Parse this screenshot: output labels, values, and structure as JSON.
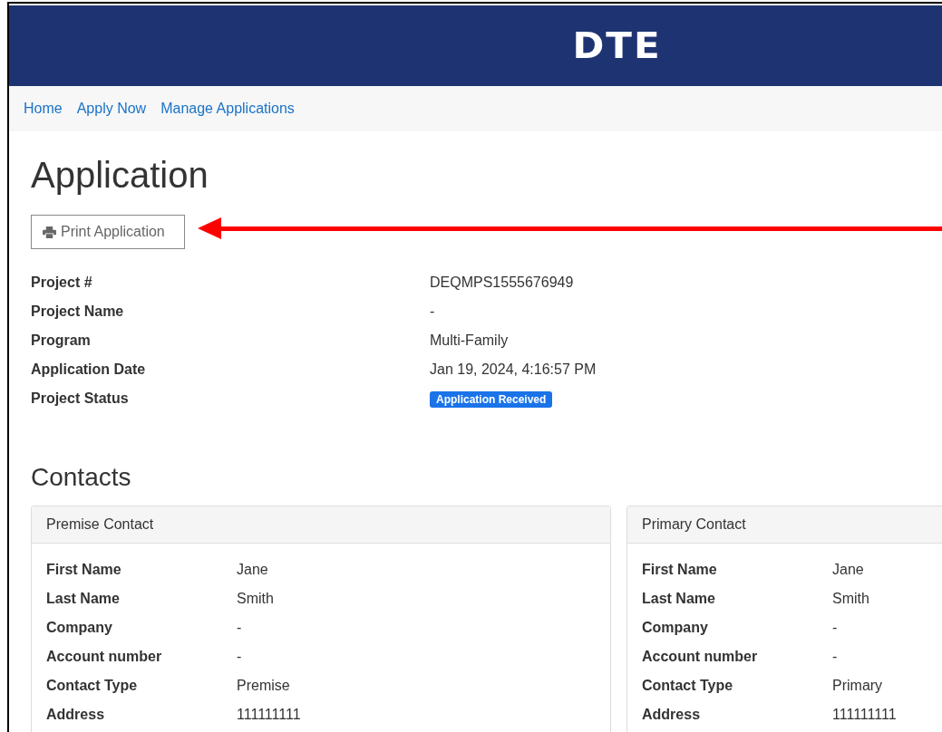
{
  "header": {
    "logo": "DTE"
  },
  "nav": [
    {
      "label": "Home"
    },
    {
      "label": "Apply Now"
    },
    {
      "label": "Manage Applications"
    }
  ],
  "page_title": "Application",
  "print_button": {
    "label": "Print Application"
  },
  "details": [
    {
      "label": "Project #",
      "value": "DEQMPS1555676949"
    },
    {
      "label": "Project Name",
      "value": "-"
    },
    {
      "label": "Program",
      "value": "Multi-Family"
    },
    {
      "label": "Application Date",
      "value": "Jan 19, 2024, 4:16:57 PM"
    },
    {
      "label": "Project Status",
      "value": "Application Received",
      "kind": "badge"
    }
  ],
  "contacts_title": "Contacts",
  "contacts": [
    {
      "title": "Premise Contact",
      "fields": [
        {
          "label": "First Name",
          "value": "Jane"
        },
        {
          "label": "Last Name",
          "value": "Smith"
        },
        {
          "label": "Company",
          "value": "-"
        },
        {
          "label": "Account number",
          "value": "-"
        },
        {
          "label": "Contact Type",
          "value": "Premise"
        },
        {
          "label": "Address",
          "value": "111111111"
        }
      ]
    },
    {
      "title": "Primary Contact",
      "fields": [
        {
          "label": "First Name",
          "value": "Jane"
        },
        {
          "label": "Last Name",
          "value": "Smith"
        },
        {
          "label": "Company",
          "value": "-"
        },
        {
          "label": "Account number",
          "value": "-"
        },
        {
          "label": "Contact Type",
          "value": "Primary"
        },
        {
          "label": "Address",
          "value": "111111111"
        }
      ]
    }
  ]
}
